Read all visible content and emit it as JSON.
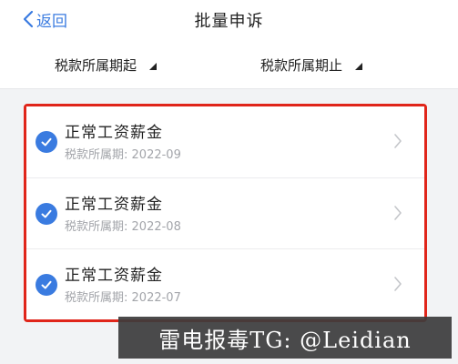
{
  "nav": {
    "back_label": "返回",
    "title": "批量申诉"
  },
  "filters": {
    "start_label": "税款所属期起",
    "end_label": "税款所属期止"
  },
  "items": [
    {
      "title": "正常工资薪金",
      "period_label": "税款所属期:",
      "period": "2022-09",
      "checked": true
    },
    {
      "title": "正常工资薪金",
      "period_label": "税款所属期:",
      "period": "2022-08",
      "checked": true
    },
    {
      "title": "正常工资薪金",
      "period_label": "税款所属期:",
      "period": "2022-07",
      "checked": true
    }
  ],
  "watermark": "雷电报毒TG: @Leidian",
  "colors": {
    "accent": "#3a7be0",
    "highlight_border": "#e0251a",
    "background": "#f2f3f5"
  }
}
